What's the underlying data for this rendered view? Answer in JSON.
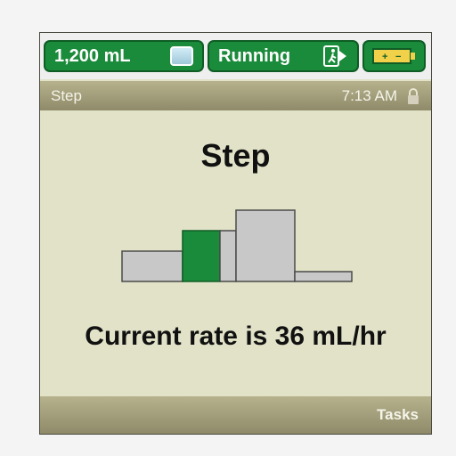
{
  "status_bar": {
    "volume": "1,200 mL",
    "state": "Running",
    "icons": {
      "bag": "iv-bag-icon",
      "run": "running-icon",
      "battery": "battery-icon"
    }
  },
  "title_bar": {
    "label": "Step",
    "time": "7:13 AM",
    "lock_icon": "lock-icon"
  },
  "main": {
    "heading": "Step",
    "message": "Current rate is 36 mL/hr",
    "current_step": 2
  },
  "footer": {
    "tasks": "Tasks"
  },
  "colors": {
    "green": "#1a8a3b",
    "panel": "#e1e2c7",
    "bar": "#8f8a69",
    "step_gray": "#c8c8c8"
  }
}
